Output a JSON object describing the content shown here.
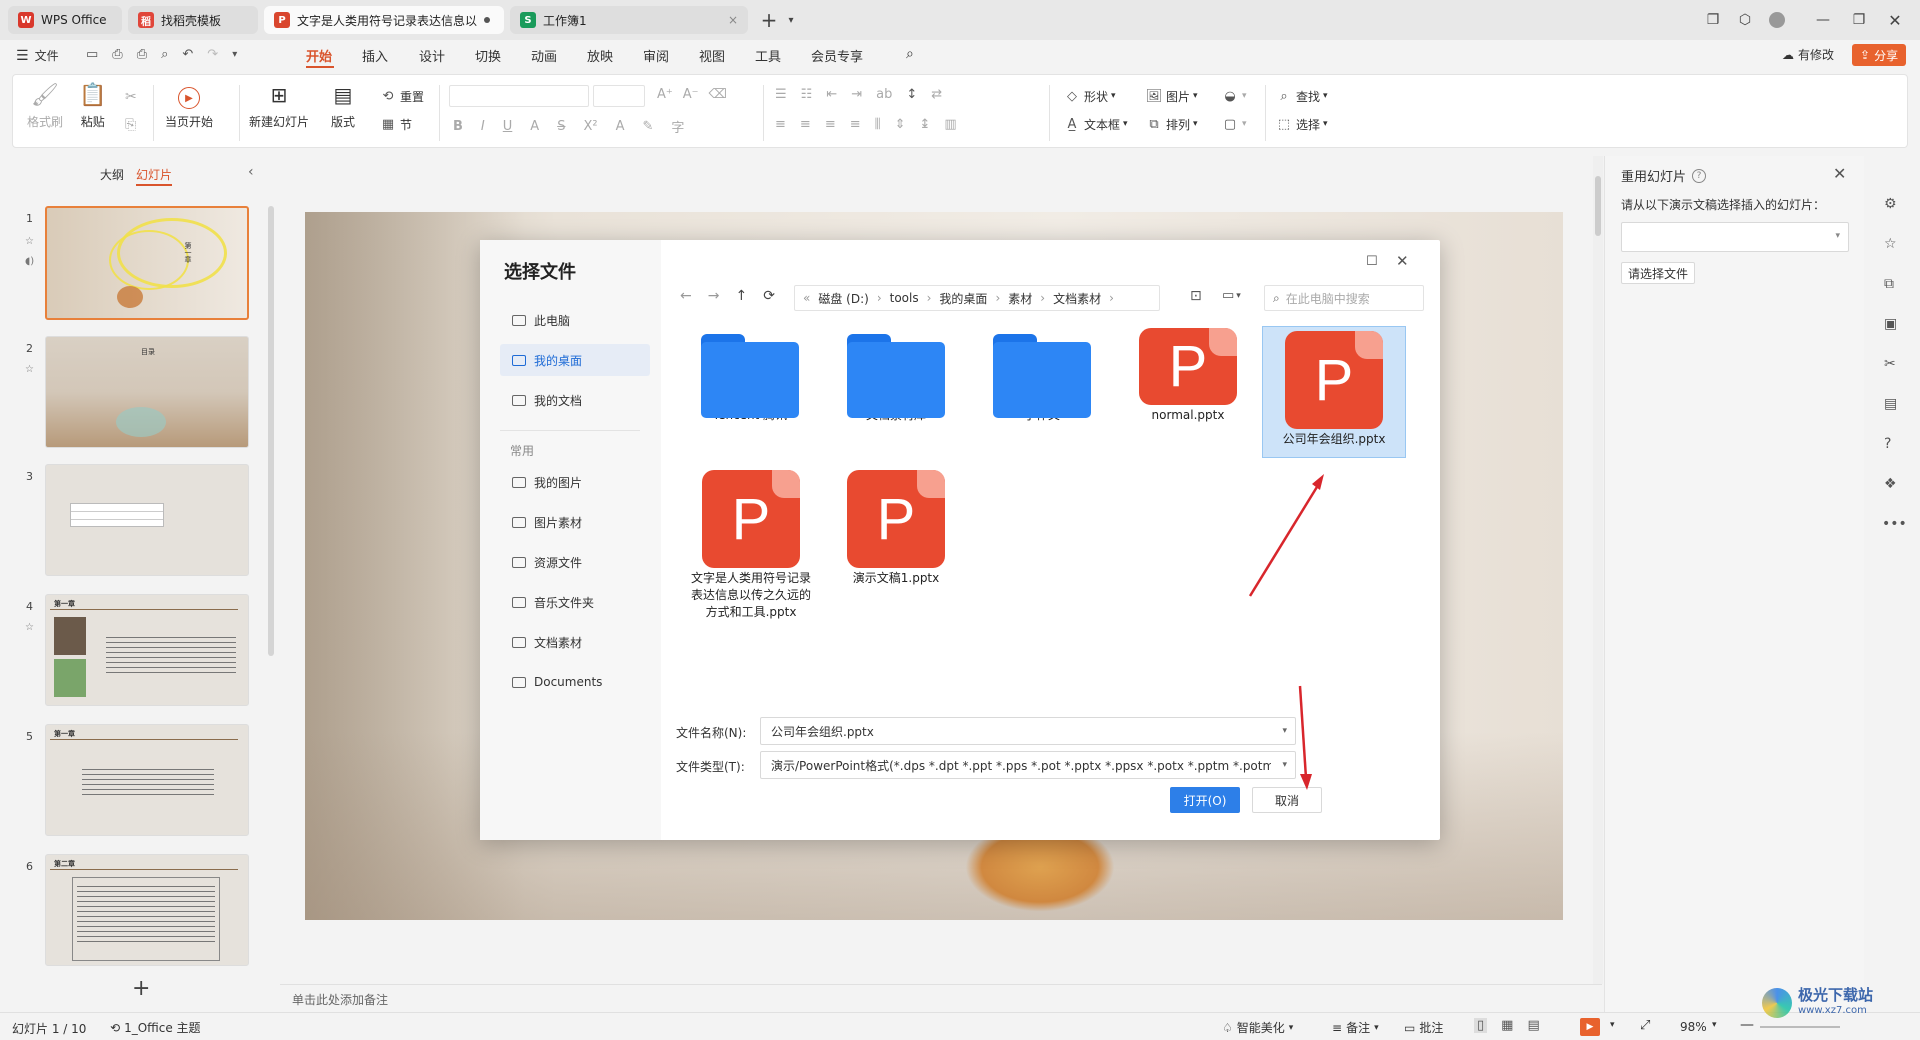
{
  "tabs": [
    {
      "label": "WPS Office"
    },
    {
      "label": "找稻壳模板"
    },
    {
      "label": "文字是人类用符号记录表达信息以"
    },
    {
      "label": "工作簿1"
    }
  ],
  "menu": {
    "file": "文件",
    "tabs": [
      "开始",
      "插入",
      "设计",
      "切换",
      "动画",
      "放映",
      "审阅",
      "视图",
      "工具",
      "会员专享"
    ],
    "active": "开始",
    "modified": "有修改",
    "share": "分享"
  },
  "ribbon": {
    "format_painter": "格式刷",
    "paste": "粘贴",
    "play_current": "当页开始",
    "new_slide": "新建幻灯片",
    "layout": "版式",
    "reset": "重置",
    "section": "节",
    "shape": "形状",
    "picture": "图片",
    "textbox": "文本框",
    "arrange": "排列",
    "find": "查找",
    "select": "选择"
  },
  "left_panel": {
    "outline_tab": "大纲",
    "slides_tab": "幻灯片",
    "slide_numbers": [
      "1",
      "2",
      "3",
      "4",
      "5",
      "6"
    ],
    "slide1_title": "第一章",
    "slide2_title": "目录",
    "slide4_title": "第一章",
    "slide5_title": "第一章",
    "slide6_title": "第二章"
  },
  "notes_placeholder": "单击此处添加备注",
  "right_panel": {
    "title": "重用幻灯片",
    "prompt": "请从以下演示文稿选择插入的幻灯片：",
    "choose_file": "请选择文件"
  },
  "dialog": {
    "title": "选择文件",
    "nav": [
      {
        "label": "此电脑"
      },
      {
        "label": "我的桌面"
      },
      {
        "label": "我的文档"
      }
    ],
    "common_header": "常用",
    "common": [
      {
        "label": "我的图片"
      },
      {
        "label": "图片素材"
      },
      {
        "label": "资源文件"
      },
      {
        "label": "音乐文件夹"
      },
      {
        "label": "文档素材"
      },
      {
        "label": "Documents"
      }
    ],
    "breadcrumb": [
      "磁盘 (D:)",
      "tools",
      "我的桌面",
      "素材",
      "文档素材"
    ],
    "search_placeholder": "在此电脑中搜索",
    "files": [
      {
        "name": "Tencent 腾讯",
        "type": "folder"
      },
      {
        "name": "文档素材库",
        "type": "folder"
      },
      {
        "name": "小作文",
        "type": "folder"
      },
      {
        "name": "normal.pptx",
        "type": "pptx"
      },
      {
        "name": "公司年会组织.pptx",
        "type": "pptx"
      },
      {
        "name": "文字是人类用符号记录表达信息以传之久远的方式和工具.pptx",
        "type": "pptx"
      },
      {
        "name": "演示文稿1.pptx",
        "type": "pptx"
      }
    ],
    "filename_label": "文件名称(N):",
    "filename_value": "公司年会组织.pptx",
    "filetype_label": "文件类型(T):",
    "filetype_value": "演示/PowerPoint格式(*.dps *.dpt *.ppt *.pps *.pot *.pptx *.ppsx *.potx *.pptm *.potm *.ppsm)",
    "open_button": "打开(O)",
    "cancel_button": "取消"
  },
  "status": {
    "slide_info": "幻灯片 1 / 10",
    "theme": "1_Office 主题",
    "beautify": "智能美化",
    "notes": "备注",
    "comments": "批注",
    "zoom": "98%"
  },
  "watermark": {
    "text": "极光下载站",
    "url": "www.xz7.com"
  },
  "colors": {
    "accent": "#d9542c",
    "primary_blue": "#2d7fe8",
    "selection": "#cde3f9",
    "ppt_red": "#e84a30",
    "folder_blue": "#2d86f5"
  }
}
